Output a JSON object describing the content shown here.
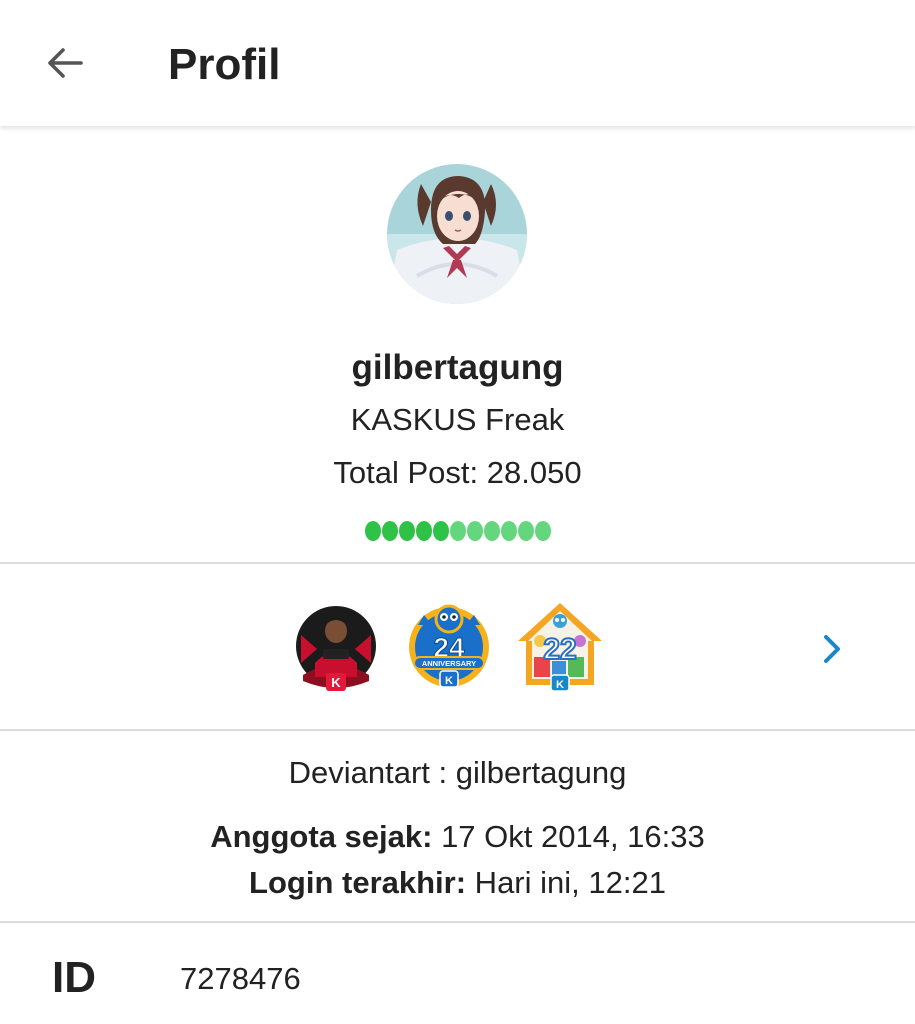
{
  "header": {
    "title": "Profil",
    "back_icon": "arrow-left-icon"
  },
  "profile": {
    "username": "gilbertagung",
    "rank": "KASKUS Freak",
    "total_post": "Total Post: 28.050",
    "reputation_dots": {
      "count": 11,
      "dark_green": 5,
      "light_green": 6,
      "colors": {
        "dark": "#2ec246",
        "light": "#64d77e"
      }
    }
  },
  "badges": {
    "items": [
      {
        "name": "kaskus-person-badge",
        "label": "K"
      },
      {
        "name": "kaskus-24-anniversary-badge",
        "number": "24",
        "text": "ANNIVERSARY",
        "label": "K"
      },
      {
        "name": "kaskus-22-house-badge",
        "number": "22",
        "label": "K"
      }
    ],
    "next_icon": "chevron-right-icon",
    "accent": "#1a87c9"
  },
  "info": {
    "deviantart": "Deviantart : gilbertagung",
    "member_since_label": "Anggota sejak:",
    "member_since_value": " 17 Okt 2014, 16:33",
    "last_login_label": "Login terakhir:",
    "last_login_value": " Hari ini, 12:21"
  },
  "id_row": {
    "label": "ID",
    "value": "7278476"
  }
}
